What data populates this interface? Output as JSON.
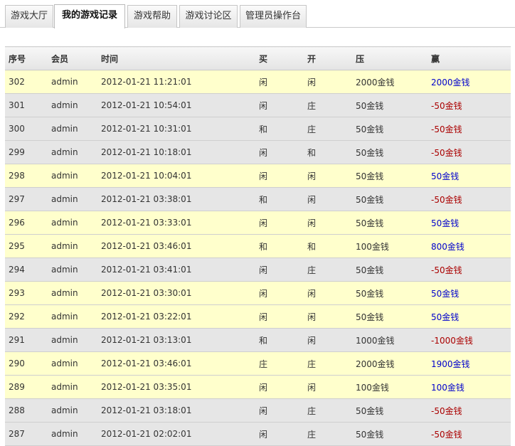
{
  "tabs": [
    {
      "label": "游戏大厅"
    },
    {
      "label": "我的游戏记录"
    },
    {
      "label": "游戏帮助"
    },
    {
      "label": "游戏讨论区"
    },
    {
      "label": "管理员操作台"
    }
  ],
  "active_tab": 1,
  "colors": {
    "row_highlight": "#ffffcc",
    "row_normal": "#e6e6e6",
    "win_positive": "#0000cc",
    "win_negative": "#aa0000"
  },
  "table": {
    "headers": [
      "序号",
      "会员",
      "时间",
      "买",
      "开",
      "压",
      "赢"
    ],
    "rows": [
      {
        "id": "302",
        "member": "admin",
        "time": "2012-01-21 11:21:01",
        "buy": "闲",
        "open": "闲",
        "bet": "2000金钱",
        "win": "2000金钱",
        "highlight": true,
        "win_positive": true
      },
      {
        "id": "301",
        "member": "admin",
        "time": "2012-01-21 10:54:01",
        "buy": "闲",
        "open": "庄",
        "bet": "50金钱",
        "win": "-50金钱",
        "highlight": false,
        "win_positive": false
      },
      {
        "id": "300",
        "member": "admin",
        "time": "2012-01-21 10:31:01",
        "buy": "和",
        "open": "庄",
        "bet": "50金钱",
        "win": "-50金钱",
        "highlight": false,
        "win_positive": false
      },
      {
        "id": "299",
        "member": "admin",
        "time": "2012-01-21 10:18:01",
        "buy": "闲",
        "open": "和",
        "bet": "50金钱",
        "win": "-50金钱",
        "highlight": false,
        "win_positive": false
      },
      {
        "id": "298",
        "member": "admin",
        "time": "2012-01-21 10:04:01",
        "buy": "闲",
        "open": "闲",
        "bet": "50金钱",
        "win": "50金钱",
        "highlight": true,
        "win_positive": true
      },
      {
        "id": "297",
        "member": "admin",
        "time": "2012-01-21 03:38:01",
        "buy": "和",
        "open": "闲",
        "bet": "50金钱",
        "win": "-50金钱",
        "highlight": false,
        "win_positive": false
      },
      {
        "id": "296",
        "member": "admin",
        "time": "2012-01-21 03:33:01",
        "buy": "闲",
        "open": "闲",
        "bet": "50金钱",
        "win": "50金钱",
        "highlight": true,
        "win_positive": true
      },
      {
        "id": "295",
        "member": "admin",
        "time": "2012-01-21 03:46:01",
        "buy": "和",
        "open": "和",
        "bet": "100金钱",
        "win": "800金钱",
        "highlight": true,
        "win_positive": true
      },
      {
        "id": "294",
        "member": "admin",
        "time": "2012-01-21 03:41:01",
        "buy": "闲",
        "open": "庄",
        "bet": "50金钱",
        "win": "-50金钱",
        "highlight": false,
        "win_positive": false
      },
      {
        "id": "293",
        "member": "admin",
        "time": "2012-01-21 03:30:01",
        "buy": "闲",
        "open": "闲",
        "bet": "50金钱",
        "win": "50金钱",
        "highlight": true,
        "win_positive": true
      },
      {
        "id": "292",
        "member": "admin",
        "time": "2012-01-21 03:22:01",
        "buy": "闲",
        "open": "闲",
        "bet": "50金钱",
        "win": "50金钱",
        "highlight": true,
        "win_positive": true
      },
      {
        "id": "291",
        "member": "admin",
        "time": "2012-01-21 03:13:01",
        "buy": "和",
        "open": "闲",
        "bet": "1000金钱",
        "win": "-1000金钱",
        "highlight": false,
        "win_positive": false
      },
      {
        "id": "290",
        "member": "admin",
        "time": "2012-01-21 03:46:01",
        "buy": "庄",
        "open": "庄",
        "bet": "2000金钱",
        "win": "1900金钱",
        "highlight": true,
        "win_positive": true
      },
      {
        "id": "289",
        "member": "admin",
        "time": "2012-01-21 03:35:01",
        "buy": "闲",
        "open": "闲",
        "bet": "100金钱",
        "win": "100金钱",
        "highlight": true,
        "win_positive": true
      },
      {
        "id": "288",
        "member": "admin",
        "time": "2012-01-21 03:18:01",
        "buy": "闲",
        "open": "庄",
        "bet": "50金钱",
        "win": "-50金钱",
        "highlight": false,
        "win_positive": false
      },
      {
        "id": "287",
        "member": "admin",
        "time": "2012-01-21 02:02:01",
        "buy": "闲",
        "open": "庄",
        "bet": "50金钱",
        "win": "-50金钱",
        "highlight": false,
        "win_positive": false
      }
    ]
  }
}
